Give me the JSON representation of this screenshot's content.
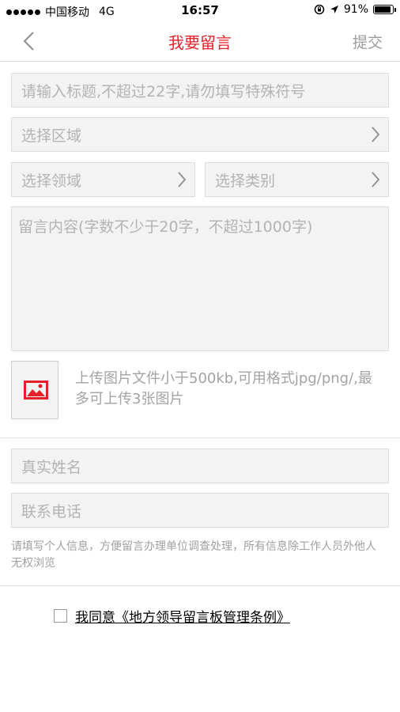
{
  "status_bar": {
    "carrier": "中国移动",
    "network": "4G",
    "time": "16:57",
    "battery": "91%",
    "battery_level": 0.91
  },
  "nav": {
    "title": "我要留言",
    "submit_label": "提交"
  },
  "form": {
    "title_placeholder": "请输入标题,不超过22字,请勿填写特殊符号",
    "region_placeholder": "选择区域",
    "domain_placeholder": "选择领域",
    "category_placeholder": "选择类别",
    "content_placeholder": "留言内容(字数不少于20字，不超过1000字)",
    "upload_hint": "上传图片文件小于500kb,可用格式jpg/png/,最多可上传3张图片",
    "name_placeholder": "真实姓名",
    "phone_placeholder": "联系电话",
    "privacy_note": "请填写个人信息，方便留言办理单位调查处理，所有信息除工作人员外他人无权浏览",
    "agree_label": "我同意《地方领导留言板管理条例》"
  },
  "colors": {
    "accent": "#e4212b",
    "field_bg": "#f3f3f3",
    "placeholder": "#b3b3b3"
  },
  "icons": {
    "back": "chevron-left-icon",
    "chevron": "chevron-right-icon",
    "upload": "image-icon"
  }
}
